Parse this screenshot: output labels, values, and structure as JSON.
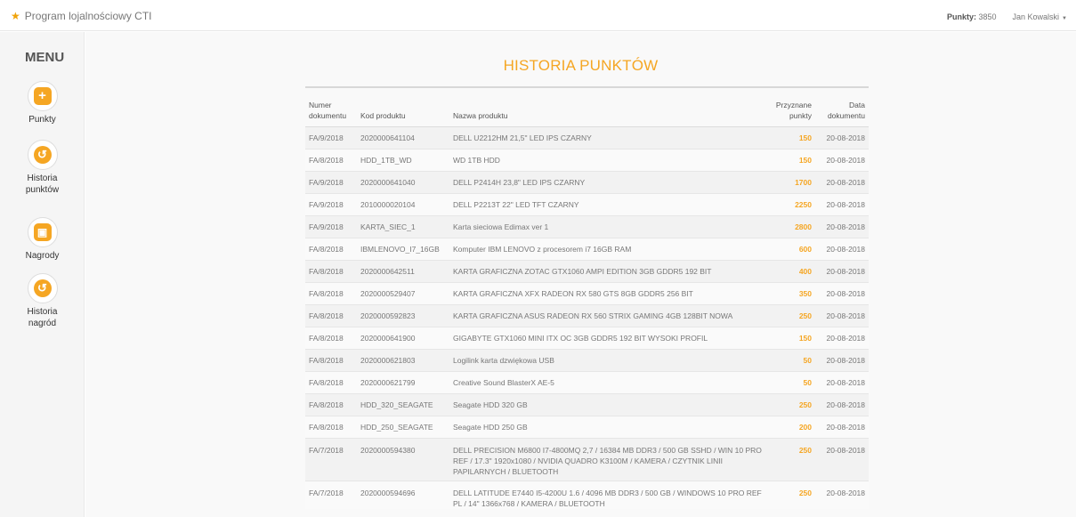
{
  "header": {
    "brand": "Program lojalnościowy CTI",
    "points_label": "Punkty:",
    "points_value": "3850",
    "user": "Jan Kowalski",
    "colors": {
      "accent": "#f5a623"
    }
  },
  "sidebar": {
    "title": "MENU",
    "items": [
      {
        "label": "Punkty",
        "icon": "plus-icon"
      },
      {
        "label": "Historia punktów",
        "icon": "history-icon"
      },
      {
        "label": "Nagrody",
        "icon": "gift-icon"
      },
      {
        "label": "Historia nagród",
        "icon": "history-icon"
      }
    ]
  },
  "main": {
    "title": "HISTORIA PUNKTÓW",
    "columns": {
      "doc_number": "Numer dokumentu",
      "product_code": "Kod produktu",
      "product_name": "Nazwa produktu",
      "points": "Przyznane punkty",
      "date": "Data dokumentu"
    },
    "rows": [
      {
        "doc": "FA/9/2018",
        "code": "2020000641104",
        "name": "DELL U2212HM 21,5\" LED IPS CZARNY",
        "points": "150",
        "date": "20-08-2018"
      },
      {
        "doc": "FA/8/2018",
        "code": "HDD_1TB_WD",
        "name": "WD 1TB HDD",
        "points": "150",
        "date": "20-08-2018"
      },
      {
        "doc": "FA/9/2018",
        "code": "2020000641040",
        "name": "DELL P2414H 23,8\" LED IPS CZARNY",
        "points": "1700",
        "date": "20-08-2018"
      },
      {
        "doc": "FA/9/2018",
        "code": "2010000020104",
        "name": "DELL P2213T 22\" LED TFT CZARNY",
        "points": "2250",
        "date": "20-08-2018"
      },
      {
        "doc": "FA/9/2018",
        "code": "KARTA_SIEC_1",
        "name": "Karta sieciowa Edimax ver 1",
        "points": "2800",
        "date": "20-08-2018"
      },
      {
        "doc": "FA/8/2018",
        "code": "IBMLENOVO_I7_16GB",
        "name": "Komputer IBM LENOVO z procesorem i7 16GB RAM",
        "points": "600",
        "date": "20-08-2018"
      },
      {
        "doc": "FA/8/2018",
        "code": "2020000642511",
        "name": "KARTA GRAFICZNA ZOTAC GTX1060 AMPI EDITION 3GB GDDR5 192 BIT",
        "points": "400",
        "date": "20-08-2018"
      },
      {
        "doc": "FA/8/2018",
        "code": "2020000529407",
        "name": "KARTA GRAFICZNA XFX RADEON RX 580 GTS 8GB GDDR5 256 BIT",
        "points": "350",
        "date": "20-08-2018"
      },
      {
        "doc": "FA/8/2018",
        "code": "2020000592823",
        "name": "KARTA GRAFICZNA ASUS RADEON RX 560 STRIX GAMING 4GB 128BIT NOWA",
        "points": "250",
        "date": "20-08-2018"
      },
      {
        "doc": "FA/8/2018",
        "code": "2020000641900",
        "name": "GIGABYTE GTX1060 MINI ITX OC 3GB GDDR5 192 BIT WYSOKI PROFIL",
        "points": "150",
        "date": "20-08-2018"
      },
      {
        "doc": "FA/8/2018",
        "code": "2020000621803",
        "name": "Logilink karta dzwiękowa USB",
        "points": "50",
        "date": "20-08-2018"
      },
      {
        "doc": "FA/8/2018",
        "code": "2020000621799",
        "name": "Creative Sound BlasterX AE-5",
        "points": "50",
        "date": "20-08-2018"
      },
      {
        "doc": "FA/8/2018",
        "code": "HDD_320_SEAGATE",
        "name": "Seagate HDD 320 GB",
        "points": "250",
        "date": "20-08-2018"
      },
      {
        "doc": "FA/8/2018",
        "code": "HDD_250_SEAGATE",
        "name": "Seagate HDD 250 GB",
        "points": "200",
        "date": "20-08-2018"
      },
      {
        "doc": "FA/7/2018",
        "code": "2020000594380",
        "name": "DELL PRECISION M6800 I7-4800MQ 2,7 / 16384 MB DDR3 / 500 GB SSHD / WIN 10 PRO REF / 17.3\" 1920x1080 / NVIDIA QUADRO K3100M / KAMERA / CZYTNIK LINII PAPILARNYCH / BLUETOOTH",
        "points": "250",
        "date": "20-08-2018"
      },
      {
        "doc": "FA/7/2018",
        "code": "2020000594696",
        "name": "DELL LATITUDE E7440 I5-4200U 1.6 / 4096 MB DDR3 / 500 GB / WINDOWS 10 PRO REF PL / 14\" 1366x768 / KAMERA / BLUETOOTH",
        "points": "250",
        "date": "20-08-2018"
      }
    ]
  }
}
